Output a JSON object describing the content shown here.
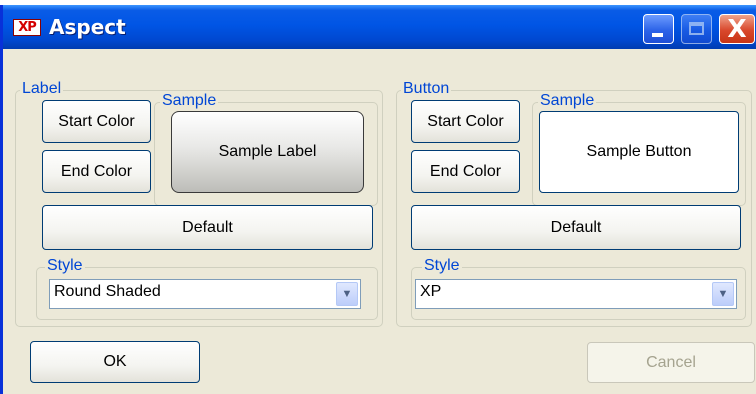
{
  "window": {
    "title": "Aspect",
    "icon_text": "XP"
  },
  "titlebar_buttons": {
    "close_glyph": "X"
  },
  "label_group": {
    "legend": "Label",
    "start_color": "Start Color",
    "end_color": "End Color",
    "sample_legend": "Sample",
    "sample_text": "Sample Label",
    "default": "Default",
    "style_legend": "Style",
    "style_value": "Round Shaded"
  },
  "button_group": {
    "legend": "Button",
    "start_color": "Start Color",
    "end_color": "End Color",
    "sample_legend": "Sample",
    "sample_text": "Sample Button",
    "default": "Default",
    "style_legend": "Style",
    "style_value": "XP"
  },
  "footer": {
    "ok": "OK",
    "cancel": "Cancel"
  },
  "icons": {
    "dropdown_arrow": "chevron-down-icon"
  }
}
